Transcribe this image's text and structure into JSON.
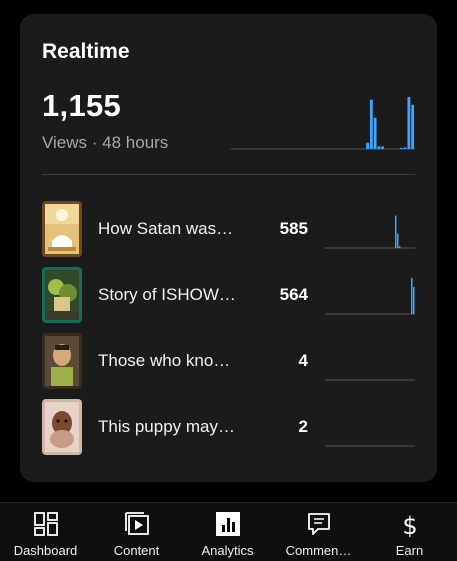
{
  "realtime": {
    "title": "Realtime",
    "total_views": "1,155",
    "subtitle": "Views · 48 hours",
    "accent_color": "#3ea6ff",
    "sparkline": [
      0,
      0,
      0,
      0,
      0,
      0,
      0,
      0,
      0,
      0,
      0,
      0,
      0,
      0,
      0,
      0,
      0,
      0,
      0,
      0,
      0,
      0,
      0,
      0,
      0,
      0,
      0,
      0,
      0,
      0,
      0,
      0,
      0,
      0,
      0,
      0,
      0.12,
      0.95,
      0.6,
      0.05,
      0.05,
      0,
      0,
      0,
      0,
      0.02,
      0.03,
      1,
      0.85
    ]
  },
  "videos": [
    {
      "title": "How Satan was…",
      "views": "585",
      "thumb": "thumb-satan",
      "sparkline": [
        0,
        0,
        0,
        0,
        0,
        0,
        0,
        0,
        0,
        0,
        0,
        0,
        0,
        0,
        0,
        0,
        0,
        0,
        0,
        0,
        0,
        0,
        0,
        0,
        0,
        0,
        0,
        0,
        0,
        0,
        0,
        0,
        0,
        0,
        0,
        0.9,
        0.4,
        0.05,
        0,
        0,
        0,
        0,
        0,
        0,
        0
      ]
    },
    {
      "title": "Story of ISHOW…",
      "views": "564",
      "thumb": "thumb-ishow",
      "sparkline": [
        0,
        0,
        0,
        0,
        0,
        0,
        0,
        0,
        0,
        0,
        0,
        0,
        0,
        0,
        0,
        0,
        0,
        0,
        0,
        0,
        0,
        0,
        0,
        0,
        0,
        0,
        0,
        0,
        0,
        0,
        0,
        0,
        0,
        0,
        0,
        0,
        0,
        0,
        0,
        0,
        0,
        0,
        0,
        1,
        0.75
      ]
    },
    {
      "title": "Those who kno…",
      "views": "4",
      "thumb": "thumb-those",
      "sparkline": []
    },
    {
      "title": "This puppy may…",
      "views": "2",
      "thumb": "thumb-puppy",
      "sparkline": []
    }
  ],
  "nav": [
    {
      "label": "Dashboard",
      "icon": "dashboard-icon"
    },
    {
      "label": "Content",
      "icon": "content-icon"
    },
    {
      "label": "Analytics",
      "icon": "analytics-icon"
    },
    {
      "label": "Commen…",
      "icon": "comments-icon"
    },
    {
      "label": "Earn",
      "icon": "earn-icon"
    }
  ]
}
